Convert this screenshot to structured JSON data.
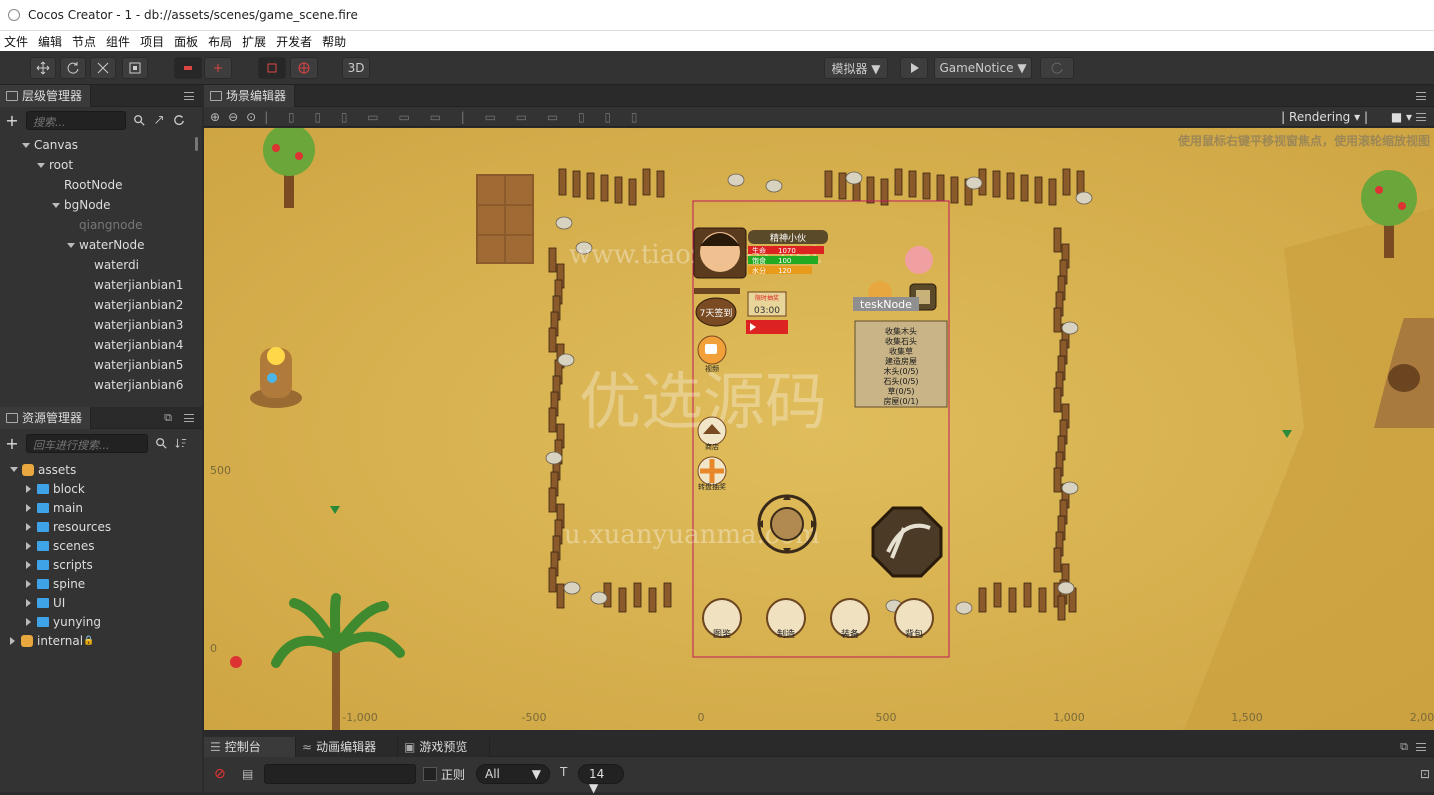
{
  "window": {
    "title": "Cocos Creator - 1 - db://assets/scenes/game_scene.fire"
  },
  "menu": [
    "文件",
    "编辑",
    "节点",
    "组件",
    "项目",
    "面板",
    "布局",
    "扩展",
    "开发者",
    "帮助"
  ],
  "toolbar": {
    "btn_3d": "3D",
    "simulator": "模拟器 ▼",
    "scene_select": "GameNotice ▼"
  },
  "hierarchy": {
    "title": "层级管理器",
    "search_placeholder": "搜索...",
    "nodes": [
      {
        "label": "Canvas",
        "depth": 0,
        "expanded": true
      },
      {
        "label": "root",
        "depth": 1,
        "expanded": true
      },
      {
        "label": "RootNode",
        "depth": 2
      },
      {
        "label": "bgNode",
        "depth": 2,
        "expanded": true
      },
      {
        "label": "qiangnode",
        "depth": 3,
        "dim": true
      },
      {
        "label": "waterNode",
        "depth": 3,
        "expanded": true
      },
      {
        "label": "waterdi",
        "depth": 4
      },
      {
        "label": "waterjianbian1",
        "depth": 4
      },
      {
        "label": "waterjianbian2",
        "depth": 4
      },
      {
        "label": "waterjianbian3",
        "depth": 4
      },
      {
        "label": "waterjianbian4",
        "depth": 4
      },
      {
        "label": "waterjianbian5",
        "depth": 4
      },
      {
        "label": "waterjianbian6",
        "depth": 4
      }
    ]
  },
  "assets": {
    "title": "资源管理器",
    "search_placeholder": "回车进行搜索...",
    "root": "assets",
    "folders": [
      "block",
      "main",
      "resources",
      "scenes",
      "scripts",
      "spine",
      "UI",
      "yunying"
    ],
    "internal": "internal"
  },
  "scene_editor": {
    "title": "场景编辑器",
    "rendering": "Rendering",
    "hint": "使用鼠标右键平移视窗焦点，使用滚轮缩放视图",
    "x_ticks": [
      "-1,000",
      "-500",
      "0",
      "500",
      "1,000",
      "1,500",
      "2,00"
    ],
    "y_ticks": [
      "500",
      "0"
    ],
    "node_label": "teskNode"
  },
  "game_ui": {
    "player_name": "精神小伙",
    "hp": "1070",
    "mp": "100",
    "exp": "120",
    "timer_title": "限时抽奖",
    "timer": "03:00",
    "signin": "7天签到",
    "video": "视频",
    "shop": "商店",
    "gift": "转盘抽奖",
    "bottom": [
      "图鉴",
      "制造",
      "装备",
      "背包"
    ],
    "task_lines": [
      "收集木头",
      "收集石头",
      "收集草",
      "建造房屋",
      "木头(0/5)",
      "石头(0/5)",
      "草(0/5)",
      "房屋(0/1)"
    ]
  },
  "watermark": {
    "url": "www.tiaozhuan.net",
    "text": "优选源码",
    "url2": "u.xuanyuanma.com"
  },
  "console": {
    "tabs": [
      "控制台",
      "动画编辑器",
      "游戏预览"
    ],
    "regex_label": "正则",
    "level": "All",
    "font_size": "14"
  },
  "colors": {
    "sand": "#d9b24e",
    "selection": "#c2185b",
    "panel": "#333333"
  }
}
